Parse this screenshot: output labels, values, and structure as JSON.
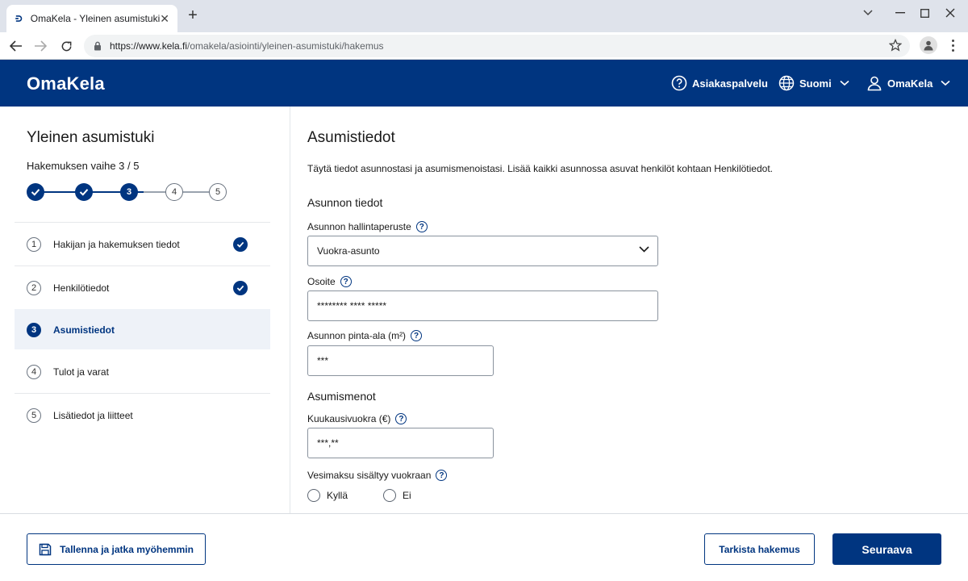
{
  "browser": {
    "tab_title": "OmaKela - Yleinen asumistuki",
    "url_host": "https://www.kela.fi",
    "url_path": "/omakela/asiointi/yleinen-asumistuki/hakemus"
  },
  "header": {
    "logo": "OmaKela",
    "customer_service": "Asiakaspalvelu",
    "language": "Suomi",
    "account": "OmaKela"
  },
  "sidebar": {
    "title": "Yleinen asumistuki",
    "step_text": "Hakemuksen vaihe 3 / 5",
    "stepper": [
      "1",
      "2",
      "3",
      "4",
      "5"
    ],
    "current_step": 3,
    "items": [
      {
        "num": "1",
        "label": "Hakijan ja hakemuksen tiedot",
        "done": true
      },
      {
        "num": "2",
        "label": "Henkilötiedot",
        "done": true
      },
      {
        "num": "3",
        "label": "Asumistiedot",
        "active": true
      },
      {
        "num": "4",
        "label": "Tulot ja varat"
      },
      {
        "num": "5",
        "label": "Lisätiedot ja liitteet"
      }
    ]
  },
  "main": {
    "title": "Asumistiedot",
    "intro": "Täytä tiedot asunnostasi ja asumismenoistasi. Lisää kaikki asunnossa asuvat henkilöt kohtaan Henkilötiedot.",
    "section_housing": "Asunnon tiedot",
    "tenure_label": "Asunnon hallintaperuste",
    "tenure_value": "Vuokra-asunto",
    "address_label": "Osoite",
    "address_value": "******** **** *****",
    "area_label": "Asunnon pinta-ala (m²)",
    "area_value": "***",
    "section_costs": "Asumismenot",
    "rent_label": "Kuukausivuokra (€)",
    "rent_value": "***,**",
    "water_label": "Vesimaksu sisältyy vuokraan",
    "radio_yes": "Kyllä",
    "radio_no": "Ei"
  },
  "footer": {
    "save_label": "Tallenna ja jatka myöhemmin",
    "review_label": "Tarkista hakemus",
    "next_label": "Seuraava"
  },
  "colors": {
    "brand": "#003580",
    "active_bg": "#eef2f8"
  }
}
